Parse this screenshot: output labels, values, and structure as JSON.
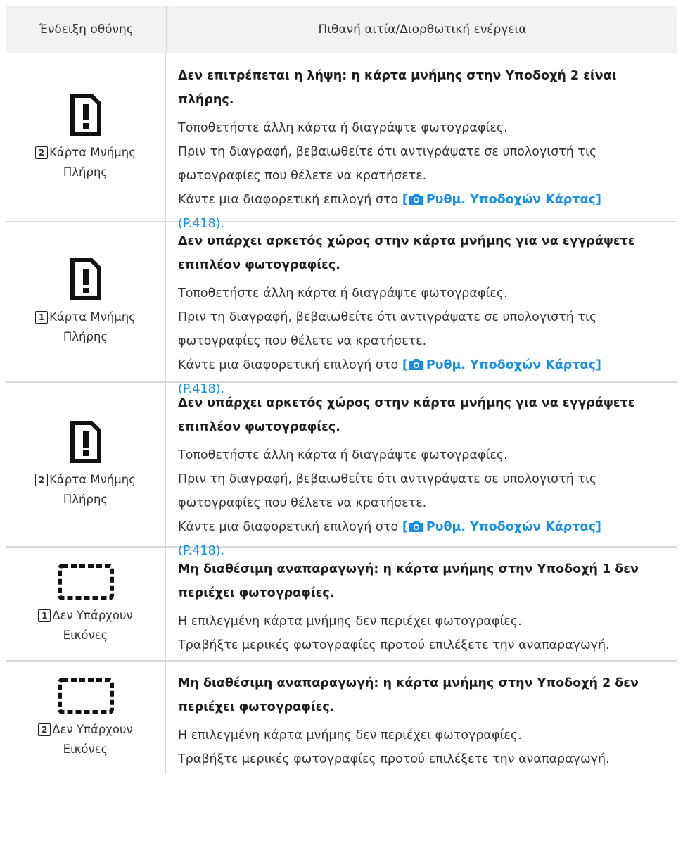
{
  "header": {
    "col1": "Ένδειξη οθόνης",
    "col2": "Πιθανή αιτία/Διορθωτική ενέργεια"
  },
  "rows": [
    {
      "icon": "card-full-icon",
      "slot": "2",
      "label_line1": "Κάρτα Μνήμης",
      "label_line2": "Πλήρης",
      "title_line1": "Δεν επιτρέπεται η λήψη: η κάρτα μνήμης στην Υποδοχή 2 είναι",
      "title_line2": "πλήρης.",
      "body_line1": "Τοποθετήστε άλλη κάρτα ή διαγράψτε φωτογραφίες.",
      "body_line2": "Πριν τη διαγραφή, βεβαιωθείτε ότι αντιγράψατε σε υπολογιστή τις",
      "body_line3": "φωτογραφίες που θέλετε να κρατήσετε.",
      "body_line4": "Κάντε μια διαφορετική επιλογή στο",
      "link_open": "[",
      "link_text": "Ρυθμ. Υποδοχών Κάρτας]",
      "page_ref": "(P.418)."
    },
    {
      "icon": "card-full-icon",
      "slot": "1",
      "label_line1": "Κάρτα Μνήμης",
      "label_line2": "Πλήρης",
      "title_line1": "Δεν υπάρχει αρκετός χώρος στην κάρτα μνήμης για να εγγράψετε",
      "title_line2": "επιπλέον φωτογραφίες.",
      "body_line1": "Τοποθετήστε άλλη κάρτα ή διαγράψτε φωτογραφίες.",
      "body_line2": "Πριν τη διαγραφή, βεβαιωθείτε ότι αντιγράψατε σε υπολογιστή τις",
      "body_line3": "φωτογραφίες που θέλετε να κρατήσετε.",
      "body_line4": "Κάντε μια διαφορετική επιλογή στο",
      "link_open": "[",
      "link_text": "Ρυθμ. Υποδοχών Κάρτας]",
      "page_ref": "(P.418)."
    },
    {
      "icon": "card-full-icon",
      "slot": "2",
      "label_line1": "Κάρτα Μνήμης",
      "label_line2": "Πλήρης",
      "title_line1": "Δεν υπάρχει αρκετός χώρος στην κάρτα μνήμης για να εγγράψετε",
      "title_line2": "επιπλέον φωτογραφίες.",
      "body_line1": "Τοποθετήστε άλλη κάρτα ή διαγράψτε φωτογραφίες.",
      "body_line2": "Πριν τη διαγραφή, βεβαιωθείτε ότι αντιγράψατε σε υπολογιστή τις",
      "body_line3": "φωτογραφίες που θέλετε να κρατήσετε.",
      "body_line4": "Κάντε μια διαφορετική επιλογή στο",
      "link_open": "[",
      "link_text": "Ρυθμ. Υποδοχών Κάρτας]",
      "page_ref": "(P.418)."
    },
    {
      "icon": "no-images-icon",
      "slot": "1",
      "label_line1": "Δεν Υπάρχουν",
      "label_line2": "Εικόνες",
      "title_line1": "Μη διαθέσιμη αναπαραγωγή: η κάρτα μνήμης στην Υποδοχή 1 δεν",
      "title_line2": "περιέχει φωτογραφίες.",
      "body_line1": "Η επιλεγμένη κάρτα μνήμης δεν περιέχει φωτογραφίες.",
      "body_line2": "Τραβήξτε μερικές φωτογραφίες προτού επιλέξετε την αναπαραγωγή."
    },
    {
      "icon": "no-images-icon",
      "slot": "2",
      "label_line1": "Δεν Υπάρχουν",
      "label_line2": "Εικόνες",
      "title_line1": "Μη διαθέσιμη αναπαραγωγή: η κάρτα μνήμης στην Υποδοχή 2 δεν",
      "title_line2": "περιέχει φωτογραφίες.",
      "body_line1": "Η επιλεγμένη κάρτα μνήμης δεν περιέχει φωτογραφίες.",
      "body_line2": "Τραβήξτε μερικές φωτογραφίες προτού επιλέξετε την αναπαραγωγή."
    }
  ]
}
